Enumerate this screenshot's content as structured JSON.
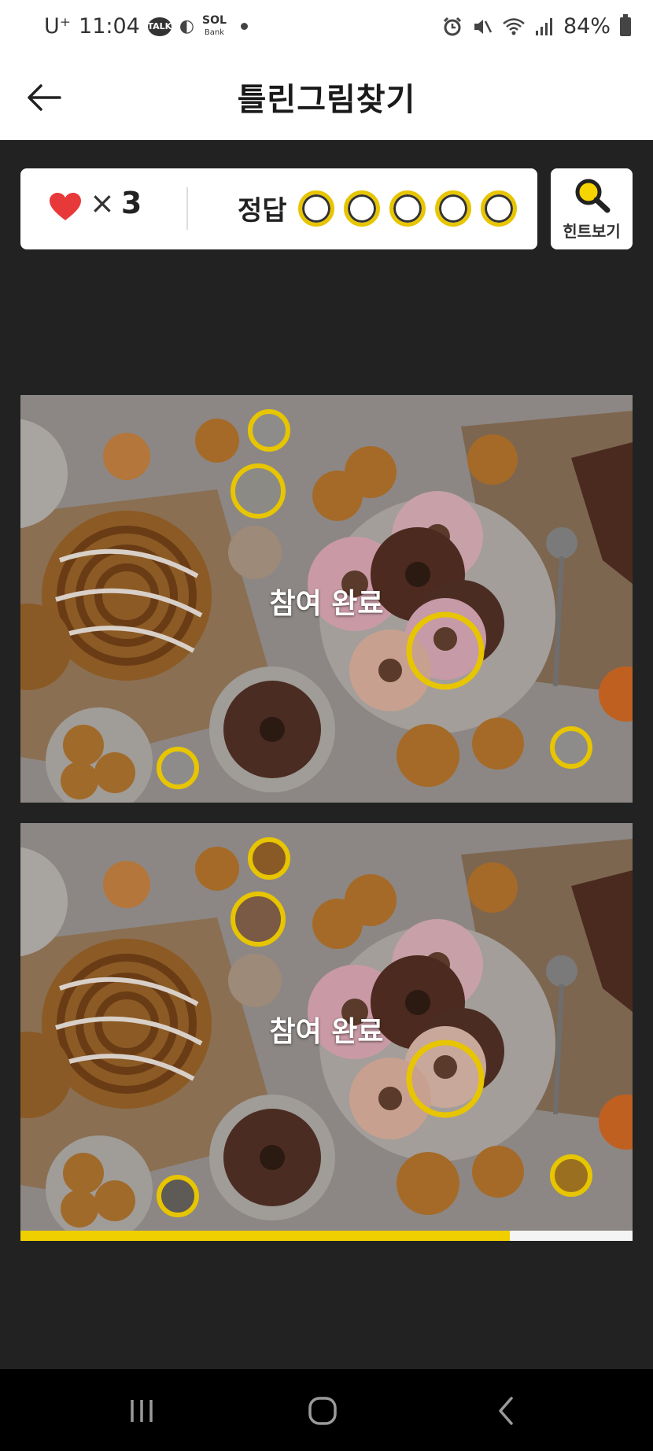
{
  "status_bar": {
    "carrier": "U⁺",
    "time": "11:04",
    "talk_badge": "TALK",
    "sol_label": "SOL\nBank",
    "battery": "84%",
    "icons": [
      "kakaotalk-icon",
      "notification-icon",
      "sol-bank-icon",
      "alarm-icon",
      "mute-icon",
      "wifi-icon",
      "signal-icon",
      "battery-icon"
    ]
  },
  "app_bar": {
    "title": "틀린그림찾기",
    "back_icon": "arrow-left-icon"
  },
  "score": {
    "lives_symbol": "×",
    "lives": "3",
    "answer_label": "정답",
    "answer_slots_total": 5,
    "heart_color": "#e8393a"
  },
  "hint_button": {
    "label": "힌트보기",
    "icon": "magnifier-icon"
  },
  "puzzles": [
    {
      "status_text": "참여 완료"
    },
    {
      "status_text": "참여 완료"
    }
  ],
  "progress": {
    "fraction": 0.8,
    "fill_color": "#f0cf00"
  },
  "nav_bar": {
    "buttons": [
      "recent-apps-icon",
      "home-icon",
      "back-icon"
    ]
  },
  "colors": {
    "accent": "#f0cf00",
    "background": "#222222"
  }
}
